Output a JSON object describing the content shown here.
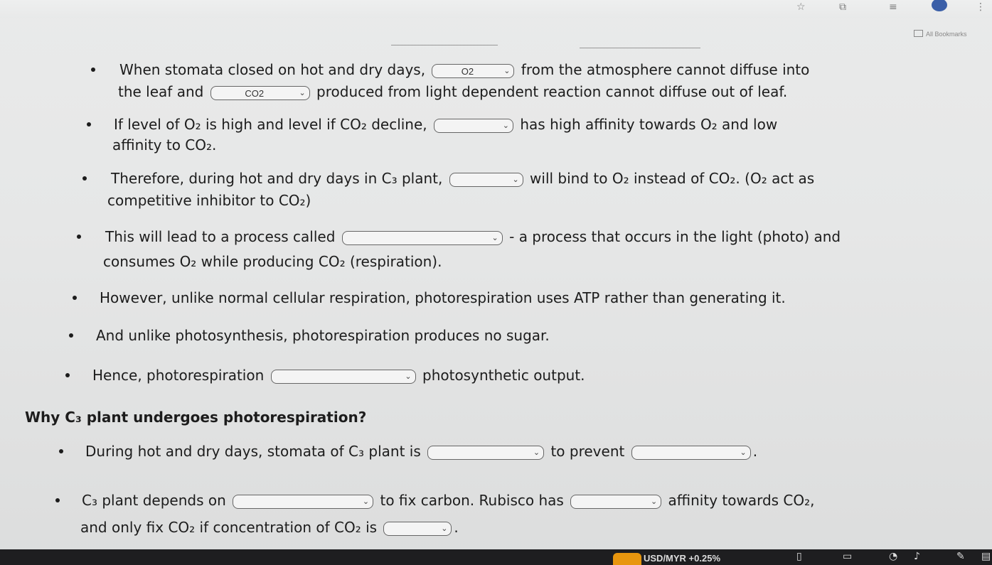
{
  "browser": {
    "bookmarks_label": "All Bookmarks"
  },
  "lines": [
    {
      "id": "l1",
      "parts": [
        {
          "t": "text",
          "v": "When stomata closed on hot and dry days, "
        },
        {
          "t": "dd",
          "v": "O2",
          "w": 116
        },
        {
          "t": "text",
          "v": " from the atmosphere cannot diffuse into"
        }
      ]
    },
    {
      "id": "l2",
      "parts": [
        {
          "t": "text",
          "v": "the leaf and "
        },
        {
          "t": "dd",
          "v": "CO2",
          "w": 140
        },
        {
          "t": "text",
          "v": " produced from light dependent reaction cannot diffuse out of leaf."
        }
      ]
    },
    {
      "id": "l3",
      "parts": [
        {
          "t": "text",
          "v": "If level of O₂ is high and level if CO₂ decline, "
        },
        {
          "t": "dd",
          "v": "",
          "w": 112
        },
        {
          "t": "text",
          "v": " has high affinity towards O₂ and low"
        }
      ]
    },
    {
      "id": "l4",
      "parts": [
        {
          "t": "text",
          "v": "affinity to CO₂."
        }
      ]
    },
    {
      "id": "l5",
      "parts": [
        {
          "t": "text",
          "v": "Therefore, during hot and dry days in C₃ plant, "
        },
        {
          "t": "dd",
          "v": "",
          "w": 104
        },
        {
          "t": "text",
          "v": " will bind to O₂ instead of CO₂. (O₂ act as"
        }
      ]
    },
    {
      "id": "l6",
      "parts": [
        {
          "t": "text",
          "v": "competitive inhibitor to CO₂)"
        }
      ]
    },
    {
      "id": "l7",
      "parts": [
        {
          "t": "text",
          "v": "This will lead to a process called "
        },
        {
          "t": "dd",
          "v": "",
          "w": 226
        },
        {
          "t": "text",
          "v": " - a process that occurs in the light (photo) and"
        }
      ]
    },
    {
      "id": "l8",
      "parts": [
        {
          "t": "text",
          "v": "consumes O₂ while producing CO₂ (respiration)."
        }
      ]
    },
    {
      "id": "l9",
      "parts": [
        {
          "t": "text",
          "v": "However, unlike normal cellular respiration, photorespiration uses ATP rather than generating it."
        }
      ]
    },
    {
      "id": "l10",
      "parts": [
        {
          "t": "text",
          "v": "And unlike photosynthesis, photorespiration produces no sugar."
        }
      ]
    },
    {
      "id": "l11",
      "parts": [
        {
          "t": "text",
          "v": "Hence, photorespiration "
        },
        {
          "t": "dd",
          "v": "",
          "w": 204
        },
        {
          "t": "text",
          "v": " photosynthetic output."
        }
      ]
    },
    {
      "id": "h1",
      "parts": [
        {
          "t": "text",
          "v": "Why C₃ plant undergoes photorespiration?"
        }
      ]
    },
    {
      "id": "l12",
      "parts": [
        {
          "t": "text",
          "v": "During hot and dry days, stomata of C₃ plant is "
        },
        {
          "t": "dd",
          "v": "",
          "w": 164
        },
        {
          "t": "text",
          "v": " to prevent "
        },
        {
          "t": "dd",
          "v": "",
          "w": 168
        },
        {
          "t": "text",
          "v": "."
        }
      ]
    },
    {
      "id": "l13",
      "parts": [
        {
          "t": "text",
          "v": "C₃ plant depends on "
        },
        {
          "t": "dd",
          "v": "",
          "w": 198
        },
        {
          "t": "text",
          "v": " to fix carbon. Rubisco has "
        },
        {
          "t": "dd",
          "v": "",
          "w": 128
        },
        {
          "t": "text",
          "v": " affinity towards CO₂,"
        }
      ]
    },
    {
      "id": "l14",
      "parts": [
        {
          "t": "text",
          "v": "and only fix CO₂ if concentration of CO₂ is "
        },
        {
          "t": "dd",
          "v": "",
          "w": 96
        },
        {
          "t": "text",
          "v": "."
        }
      ]
    }
  ],
  "taskbar": {
    "status_text": "USD/MYR +0.25%"
  }
}
